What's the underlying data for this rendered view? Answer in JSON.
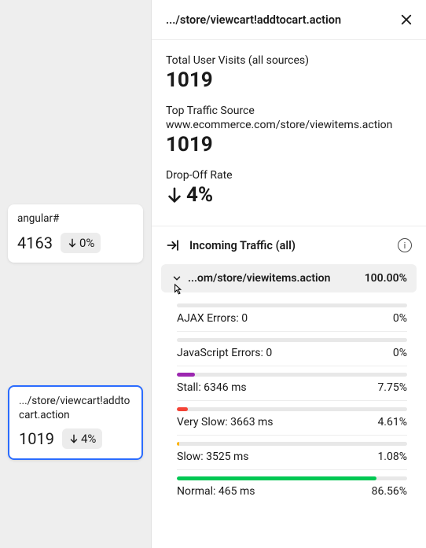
{
  "cards": [
    {
      "title": "angular#",
      "value": "4163",
      "delta": "0%"
    },
    {
      "title": ".../store/viewcart!addtocart.action",
      "value": "1019",
      "delta": "4%"
    }
  ],
  "panel": {
    "title": ".../store/viewcart!addtocart.action",
    "stats": {
      "visits_label": "Total User Visits (all sources)",
      "visits_value": "1019",
      "source_label": "Top Traffic Source",
      "source_sub": "www.ecommerce.com/store/viewitems.action",
      "source_value": "1019",
      "drop_label": "Drop-Off Rate",
      "drop_value": "4%"
    },
    "incoming_label": "Incoming Traffic (all)",
    "accordion": {
      "title": "...om/store/viewitems.action",
      "pct": "100.00%"
    },
    "metrics": [
      {
        "label": "AJAX Errors: 0",
        "pct": "0%",
        "width": "0%",
        "color": "#9c27b0"
      },
      {
        "label": "JavaScript Errors: 0",
        "pct": "0%",
        "width": "0%",
        "color": "#9c27b0"
      },
      {
        "label": "Stall: 6346 ms",
        "pct": "7.75%",
        "width": "7.75%",
        "color": "#9c27b0"
      },
      {
        "label": "Very Slow: 3663 ms",
        "pct": "4.61%",
        "width": "4.61%",
        "color": "#f44336"
      },
      {
        "label": "Slow: 3525 ms",
        "pct": "1.08%",
        "width": "1.08%",
        "color": "#ffb300"
      },
      {
        "label": "Normal: 465 ms",
        "pct": "86.56%",
        "width": "86.56%",
        "color": "#00c853"
      }
    ]
  }
}
